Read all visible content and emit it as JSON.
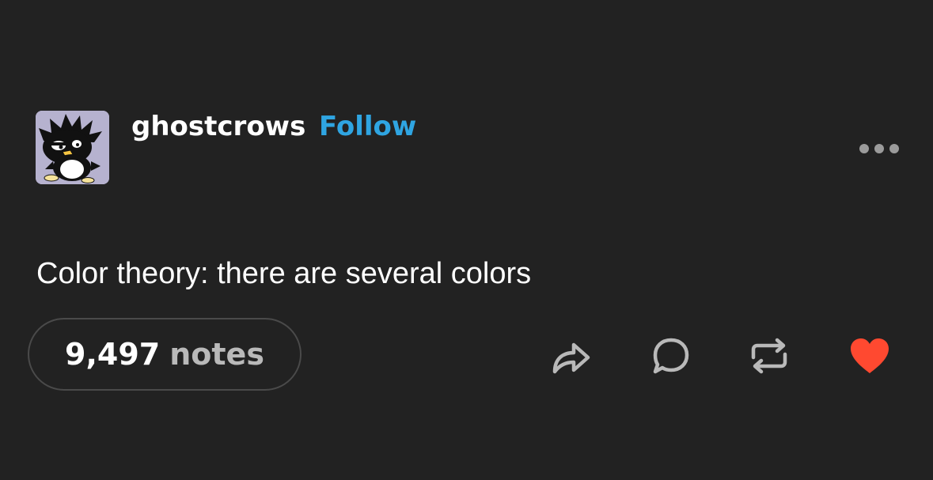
{
  "post": {
    "username": "ghostcrows",
    "follow_label": "Follow",
    "body": "Color theory: there are several colors",
    "notes_count": "9,497",
    "notes_label": "notes",
    "liked": true
  },
  "icons": {
    "more": "more-dots-icon",
    "share": "share-icon",
    "reply": "reply-icon",
    "reblog": "reblog-icon",
    "like": "heart-icon"
  },
  "colors": {
    "background": "#222222",
    "follow": "#2fa5e2",
    "like": "#ff4930",
    "icon": "#b9b9b9"
  }
}
